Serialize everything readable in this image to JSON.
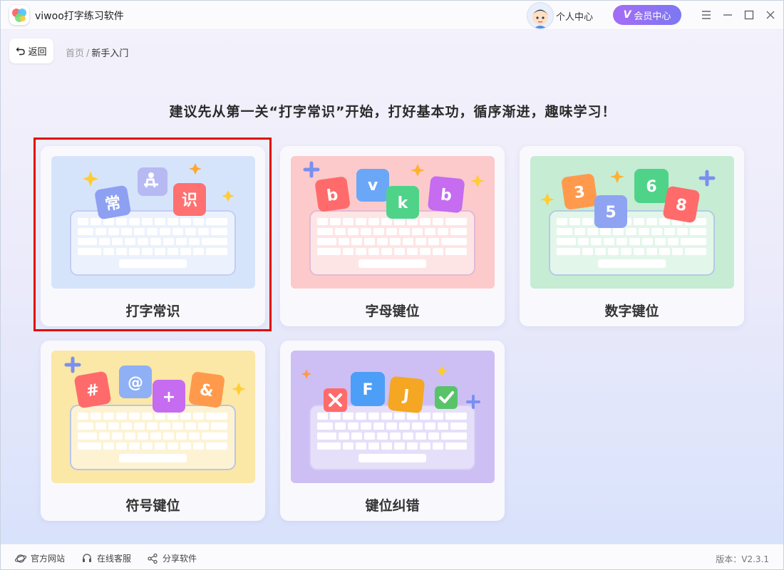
{
  "app": {
    "title": "viwoo打字练习软件"
  },
  "header": {
    "personal_label": "个人中心",
    "vip_label": "会员中心",
    "vip_mark": "V"
  },
  "nav": {
    "back_label": "返回",
    "breadcrumb": [
      "首页",
      "新手入门"
    ],
    "separator": "/"
  },
  "main": {
    "headline": "建议先从第一关“打字常识”开始，打好基本功，循序渐进，趣味学习！",
    "selected_card": "打字常识",
    "cards": [
      {
        "label": "打字常识",
        "bg": "#d6e4fb",
        "keys": [
          "常",
          "识"
        ]
      },
      {
        "label": "字母键位",
        "bg": "#fccacb",
        "keys": [
          "b",
          "v",
          "k",
          "b"
        ]
      },
      {
        "label": "数字键位",
        "bg": "#c6ecd4",
        "keys": [
          "3",
          "5",
          "6",
          "8"
        ]
      },
      {
        "label": "符号键位",
        "bg": "#fbe7a6",
        "keys": [
          "#",
          "@",
          "+",
          "&"
        ]
      },
      {
        "label": "键位纠错",
        "bg": "#cdbff4",
        "keys": [
          "F",
          "J"
        ]
      }
    ]
  },
  "footer": {
    "links": [
      "官方网站",
      "在线客服",
      "分享软件"
    ],
    "version": "版本：V2.3.1"
  },
  "colors": {
    "accent": "#8a6ff3",
    "selection": "#e10a0a"
  }
}
